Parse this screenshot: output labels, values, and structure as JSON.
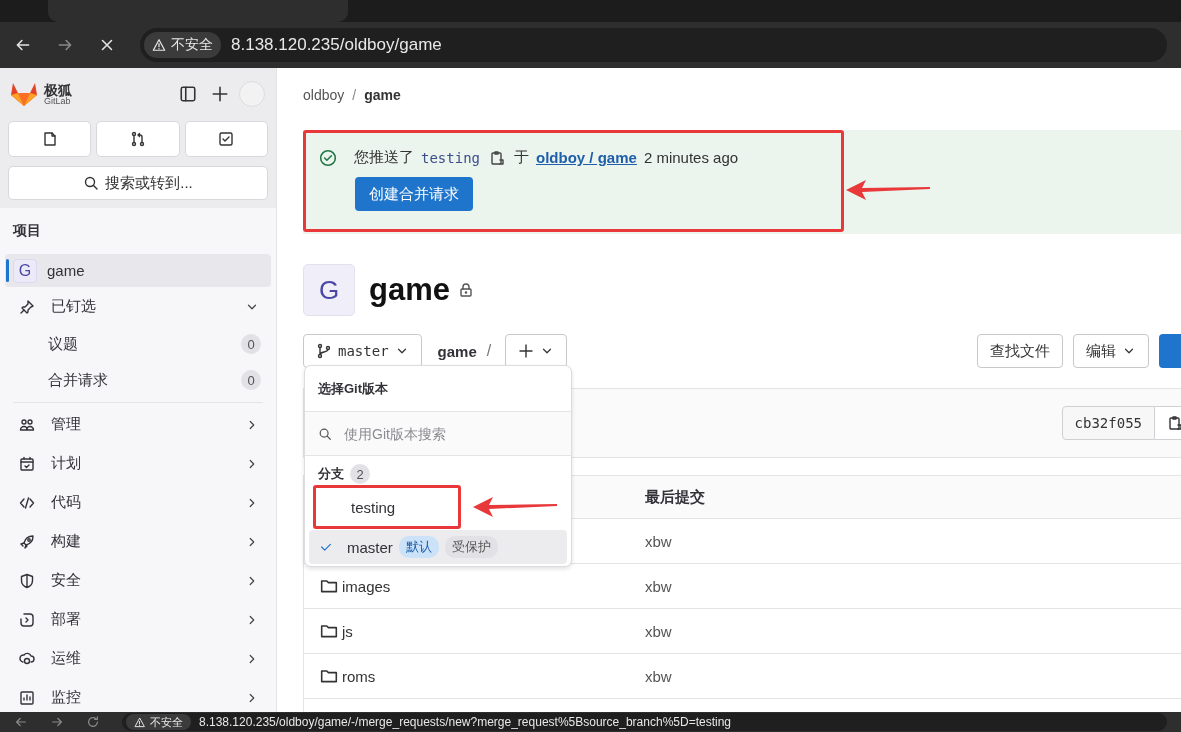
{
  "browser": {
    "security_label": "不安全",
    "url": "8.138.120.235/oldboy/game"
  },
  "sidebar": {
    "brand": {
      "name": "极狐",
      "sub": "GitLab"
    },
    "search": {
      "placeholder": "搜索或转到..."
    },
    "section": "项目",
    "project": {
      "initial": "G",
      "name": "game",
      "selected": true
    },
    "pinned": {
      "label": "已钉选",
      "expanded": true,
      "children": [
        {
          "label": "议题",
          "count": "0"
        },
        {
          "label": "合并请求",
          "count": "0"
        }
      ]
    },
    "items": [
      {
        "kind": "manage",
        "label": "管理"
      },
      {
        "kind": "plan",
        "label": "计划"
      },
      {
        "kind": "code",
        "label": "代码"
      },
      {
        "kind": "build",
        "label": "构建"
      },
      {
        "kind": "secure",
        "label": "安全"
      },
      {
        "kind": "deploy",
        "label": "部署"
      },
      {
        "kind": "operate",
        "label": "运维"
      },
      {
        "kind": "monitor",
        "label": "监控"
      }
    ]
  },
  "breadcrumb": {
    "items": [
      "oldboy",
      "game"
    ],
    "separator": "/"
  },
  "alert": {
    "highlighted": true,
    "before": "您推送了",
    "branch": "testing",
    "middle": "于",
    "link": "oldboy / game",
    "after": "2 minutes ago",
    "button": "创建合并请求"
  },
  "project": {
    "initial": "G",
    "title": "game",
    "private": true
  },
  "toolbar": {
    "branch": "master",
    "path": "game",
    "separator": "/",
    "find_file": "查找文件",
    "edit": "编辑"
  },
  "commit": {
    "sha": "cb32f055"
  },
  "table": {
    "columns": [
      "最后提交"
    ],
    "rows": [
      {
        "name": null,
        "last_commit": "xbw"
      },
      {
        "name": "images",
        "last_commit": "xbw"
      },
      {
        "name": "js",
        "last_commit": "xbw"
      },
      {
        "name": "roms",
        "last_commit": "xbw"
      }
    ]
  },
  "ref_dropdown": {
    "title": "选择Git版本",
    "placeholder": "使用Git版本搜索",
    "section": "分支",
    "count": "2",
    "branches": [
      {
        "name": "testing",
        "selected": false,
        "highlighted": true
      },
      {
        "name": "master",
        "selected": true,
        "highlighted": false,
        "badges": [
          {
            "kind": "default",
            "label": "默认"
          },
          {
            "kind": "protected",
            "label": "受保护"
          }
        ]
      }
    ]
  },
  "bottom_browser": {
    "security_label": "不安全",
    "url": "8.138.120.235/oldboy/game/-/merge_requests/new?merge_request%5Bsource_branch%5D=testing"
  }
}
